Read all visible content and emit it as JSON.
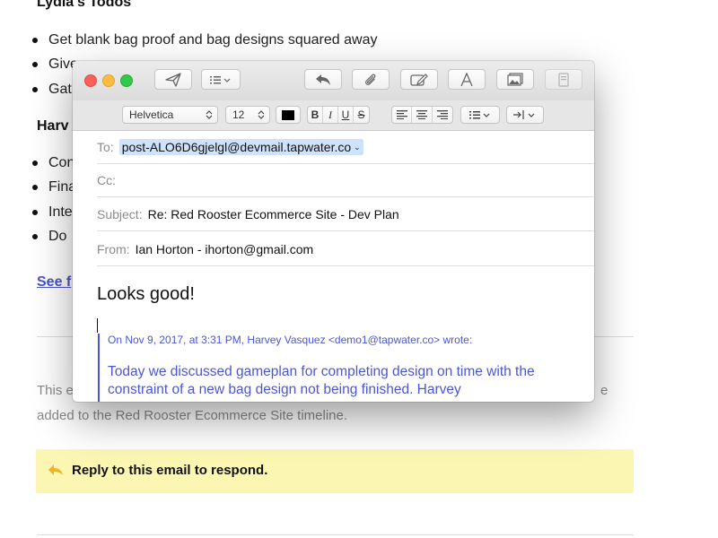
{
  "background": {
    "heading": "Lydia's Todos",
    "list1": [
      "Get blank bag proof and bag designs squared away",
      "Give",
      "Gat"
    ],
    "list2_heading": "Harv",
    "list2": [
      "Con",
      "Fina",
      "Inte",
      "Do"
    ],
    "see_link": "See f",
    "para_line1": "This e",
    "para_tail": "e",
    "para_line2": "added to the Red Rooster Ecommerce Site timeline.",
    "reply_text": "Reply to this email to respond.",
    "colors": {
      "link": "#4a53c8",
      "reply_bg": "#fbf7b3",
      "reply_icon": "#f0b429"
    }
  },
  "compose": {
    "toolbar_icons": [
      "send-icon",
      "list-icon",
      "reply-icon",
      "attachment-icon",
      "markup-icon",
      "font-icon",
      "photo-icon",
      "format-icon"
    ],
    "font_family": "Helvetica",
    "font_size": "12",
    "style_buttons": [
      "B",
      "I",
      "U",
      "S"
    ],
    "to_label": "To:",
    "to_value": "post-ALO6D6gjelgl@devmail.tapwater.co",
    "cc_label": "Cc:",
    "cc_value": "",
    "subject_label": "Subject:",
    "subject_value": "Re: Red Rooster Ecommerce Site - Dev Plan",
    "from_label": "From:",
    "from_value": "Ian Horton - ihorton@gmail.com",
    "greeting": "Looks good!",
    "quote_header": "On Nov 9, 2017, at 3:31 PM, Harvey Vasquez <demo1@tapwater.co> wrote:",
    "quote_body": "Today we discussed gameplan for completing design on time with the constraint of a new bag design not being finished. Harvey",
    "colors": {
      "quote": "#4b56d2",
      "token_bg": "#cfe2fb"
    }
  }
}
